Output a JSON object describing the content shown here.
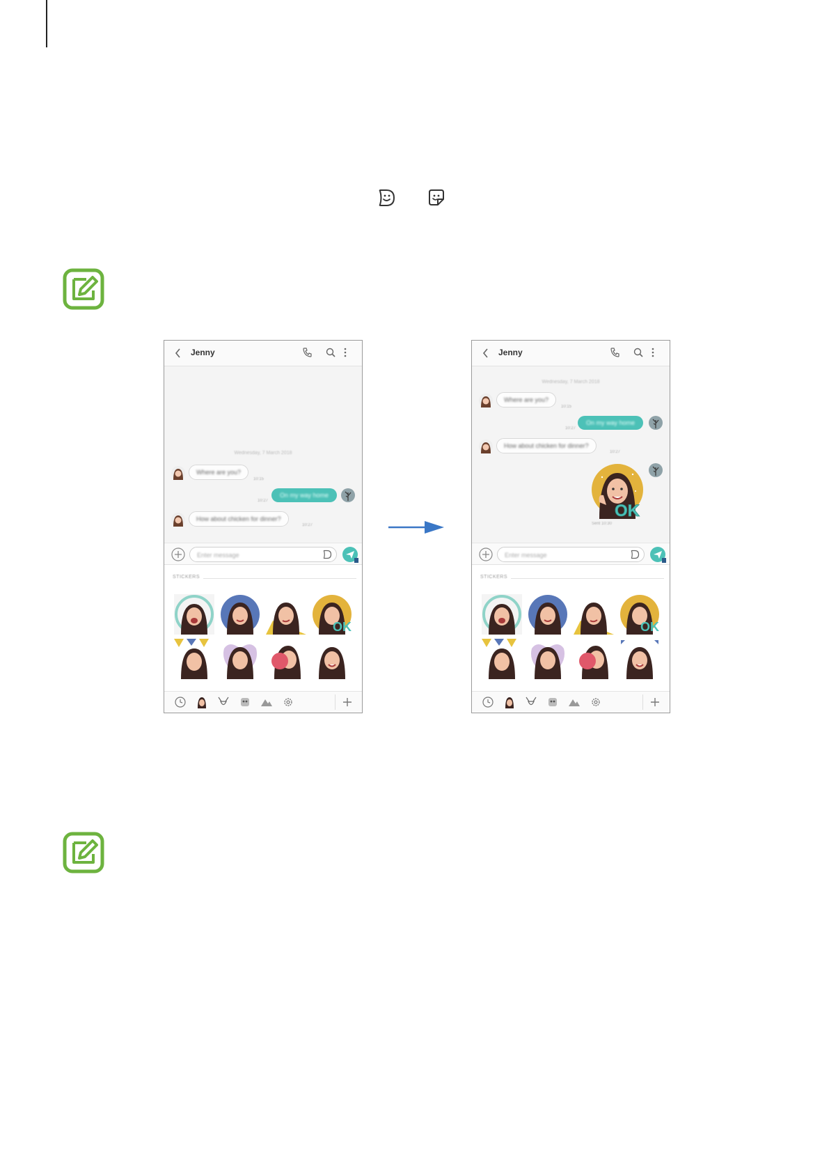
{
  "page": {
    "note_icon_label": "Note",
    "inline_icons": [
      "emoji-sticker-icon",
      "sticker-icon"
    ]
  },
  "screens": [
    {
      "contact": "Jenny",
      "date": "Wednesday, 7 March 2018",
      "messages": [
        {
          "dir": "in",
          "text": "Where are you?",
          "time": "10:15"
        },
        {
          "dir": "out",
          "text": "On my way home",
          "time": "10:27"
        },
        {
          "dir": "in",
          "text": "How about chicken for dinner?",
          "time": "10:27"
        }
      ],
      "sent_sticker": false,
      "composer_placeholder": "Enter message",
      "stickers_label": "STICKERS"
    },
    {
      "contact": "Jenny",
      "date": "Wednesday, 7 March 2018",
      "messages": [
        {
          "dir": "in",
          "text": "Where are you?",
          "time": "10:15"
        },
        {
          "dir": "out",
          "text": "On my way home",
          "time": "10:27"
        },
        {
          "dir": "in",
          "text": "How about chicken for dinner?",
          "time": "10:27"
        }
      ],
      "sent_sticker": true,
      "sticker_caption": "OK",
      "sticker_time": "Sent 10:30",
      "composer_placeholder": "Enter message",
      "stickers_label": "STICKERS"
    }
  ],
  "colors": {
    "note_green": "#6db33f",
    "bubble_out": "#4cc1b7",
    "arrow_blue": "#3a77c6"
  }
}
